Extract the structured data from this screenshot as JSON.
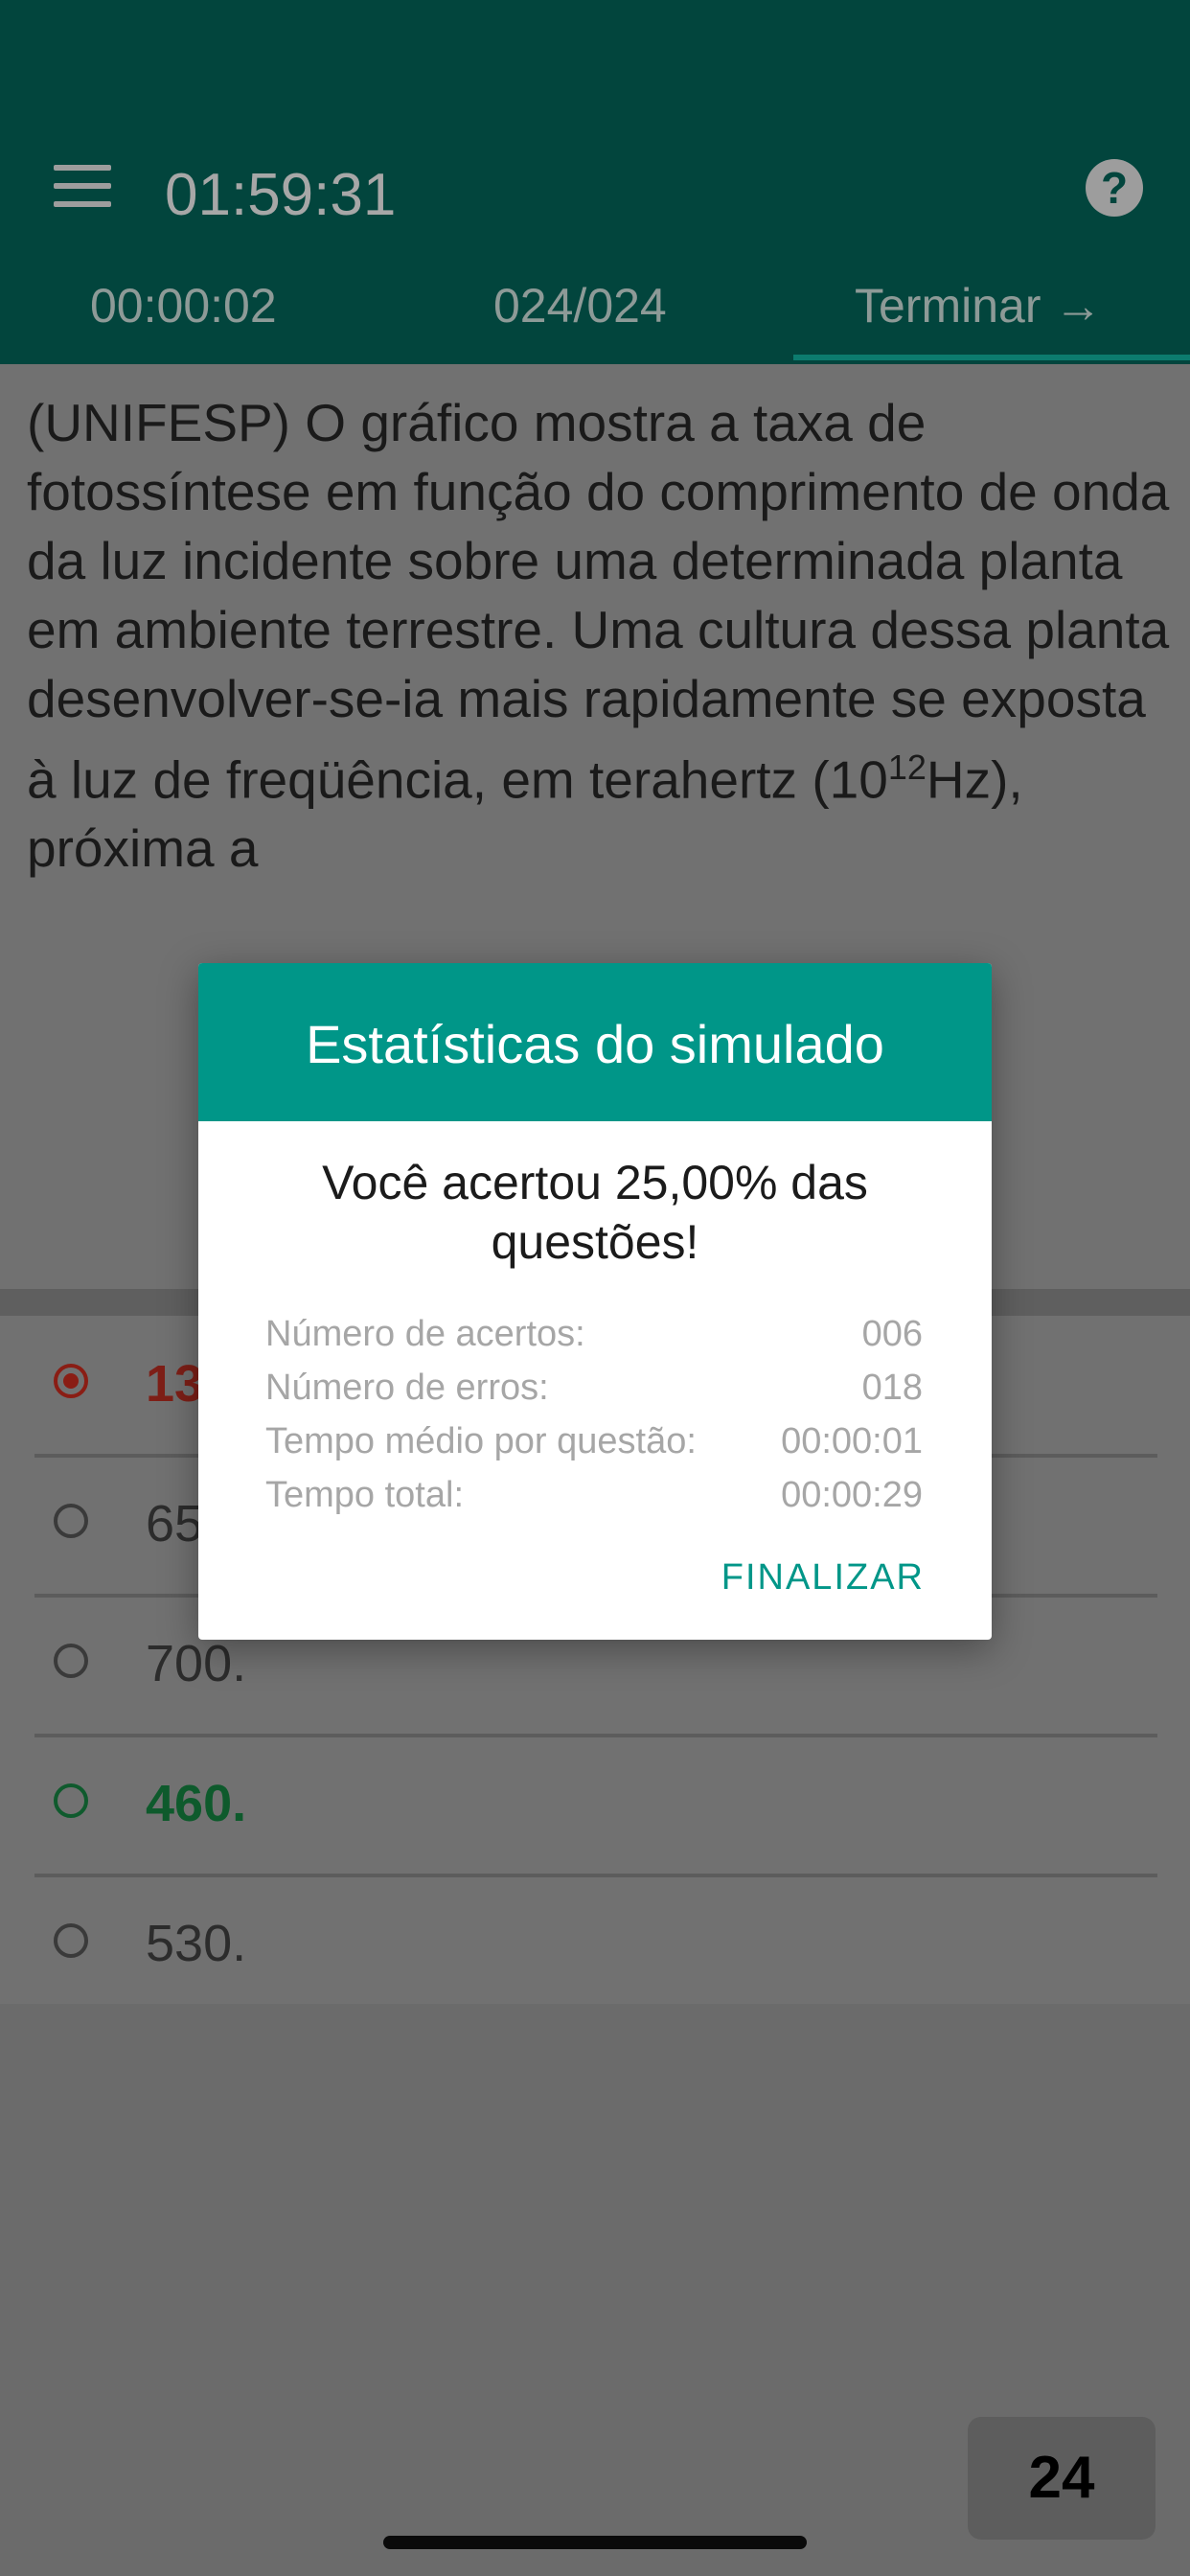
{
  "appbar": {
    "clock": "01:59:31",
    "tabs": {
      "elapsed": "00:00:02",
      "counter": "024/024",
      "finish": "Terminar →"
    },
    "help_glyph": "?",
    "menu_icon": "menu-icon",
    "help_icon": "help-icon"
  },
  "question": {
    "text_part1": "(UNIFESP) O gráfico mostra a taxa de fotossíntese em função do comprimento de onda da luz incidente sobre uma determinada planta em ambiente terrestre. Uma cultura dessa planta desenvolver-se-ia mais rapidamente se exposta à luz de freqüência, em terahertz (10",
    "text_sup": "12",
    "text_part2": "Hz), próxima a"
  },
  "options": [
    {
      "text": "13",
      "state": "selected-wrong"
    },
    {
      "text": "65",
      "state": "normal"
    },
    {
      "text": "700.",
      "state": "normal"
    },
    {
      "text": "460.",
      "state": "correct"
    },
    {
      "text": "530.",
      "state": "normal"
    }
  ],
  "modal": {
    "title": "Estatísticas do simulado",
    "summary": "Você acertou 25,00% das questões!",
    "stats": [
      {
        "label": "Número de acertos:",
        "value": "006"
      },
      {
        "label": "Número de erros:",
        "value": "018"
      },
      {
        "label": "Tempo médio por questão:",
        "value": "00:00:01"
      },
      {
        "label": "Tempo total:",
        "value": "00:00:29"
      }
    ],
    "finish_label": "FINALIZAR"
  },
  "page_badge": "24",
  "colors": {
    "appbar": "#02453d",
    "accent": "#009688",
    "wrong": "#c62828",
    "correct": "#1b7a3d"
  }
}
